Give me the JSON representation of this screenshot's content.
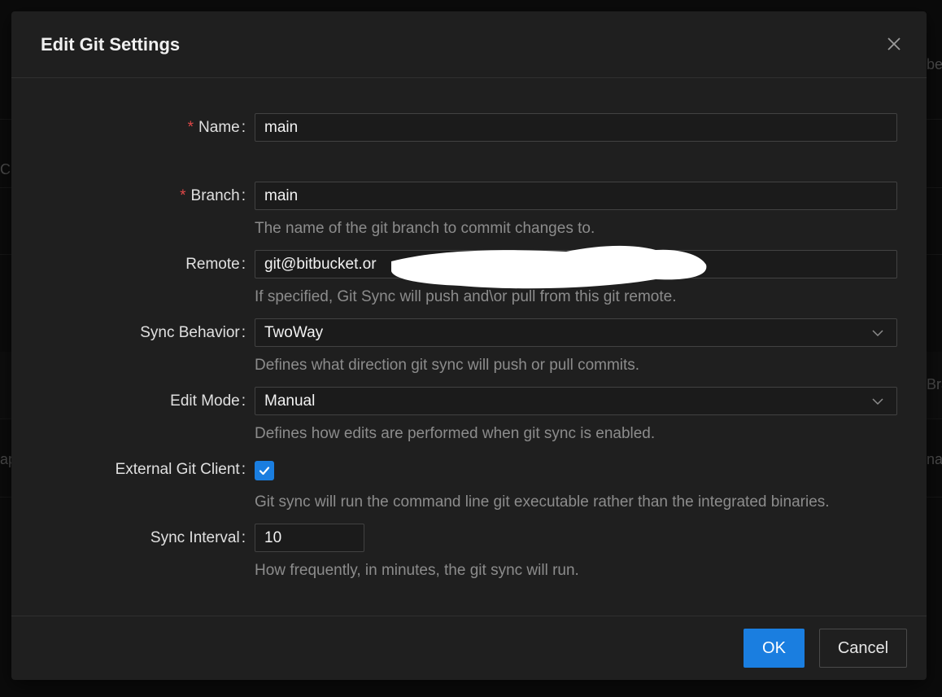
{
  "background": {
    "fragments": [
      "be",
      "Cr",
      "Bra",
      "ap",
      "na"
    ]
  },
  "dialog": {
    "title": "Edit Git Settings",
    "close_icon": "close-icon"
  },
  "fields": {
    "name": {
      "label": "Name",
      "value": "main",
      "required": true
    },
    "branch": {
      "label": "Branch",
      "value": "main",
      "required": true,
      "help": "The name of the git branch to commit changes to."
    },
    "remote": {
      "label": "Remote",
      "value": "git@bitbucket.or",
      "help": "If specified, Git Sync will push and\\or pull from this git remote."
    },
    "sync_behavior": {
      "label": "Sync Behavior",
      "value": "TwoWay",
      "help": "Defines what direction git sync will push or pull commits."
    },
    "edit_mode": {
      "label": "Edit Mode",
      "value": "Manual",
      "help": "Defines how edits are performed when git sync is enabled."
    },
    "external_git_client": {
      "label": "External Git Client",
      "checked": true,
      "help": "Git sync will run the command line git executable rather than the integrated binaries."
    },
    "sync_interval": {
      "label": "Sync Interval",
      "value": "10",
      "help": "How frequently, in minutes, the git sync will run."
    }
  },
  "footer": {
    "ok_label": "OK",
    "cancel_label": "Cancel"
  },
  "colors": {
    "accent": "#1a7ee0",
    "required": "#e04848",
    "modal_bg": "#1f1f1f"
  }
}
